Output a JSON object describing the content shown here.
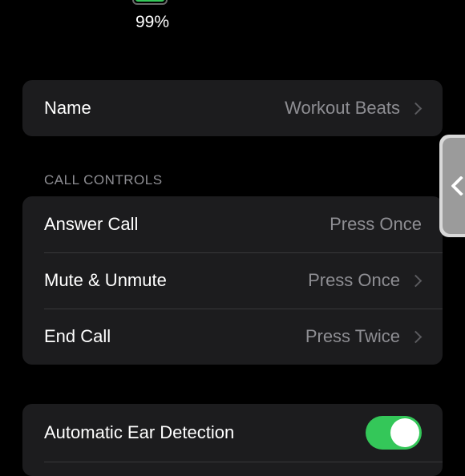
{
  "battery": {
    "percent_label": "99%",
    "level": 0.99,
    "color": "#34c759"
  },
  "name_row": {
    "label": "Name",
    "value": "Workout Beats"
  },
  "call_controls": {
    "header": "CALL CONTROLS",
    "rows": [
      {
        "label": "Answer Call",
        "value": "Press Once",
        "chevron": false
      },
      {
        "label": "Mute & Unmute",
        "value": "Press Once",
        "chevron": true
      },
      {
        "label": "End Call",
        "value": "Press Twice",
        "chevron": true
      }
    ]
  },
  "ear_detection": {
    "label": "Automatic Ear Detection",
    "toggle_on": true,
    "toggle_color": "#34c759"
  },
  "colors": {
    "background": "#000000",
    "card": "#1c1c1e",
    "secondary_text": "#8e8e93",
    "accent_green": "#34c759"
  }
}
